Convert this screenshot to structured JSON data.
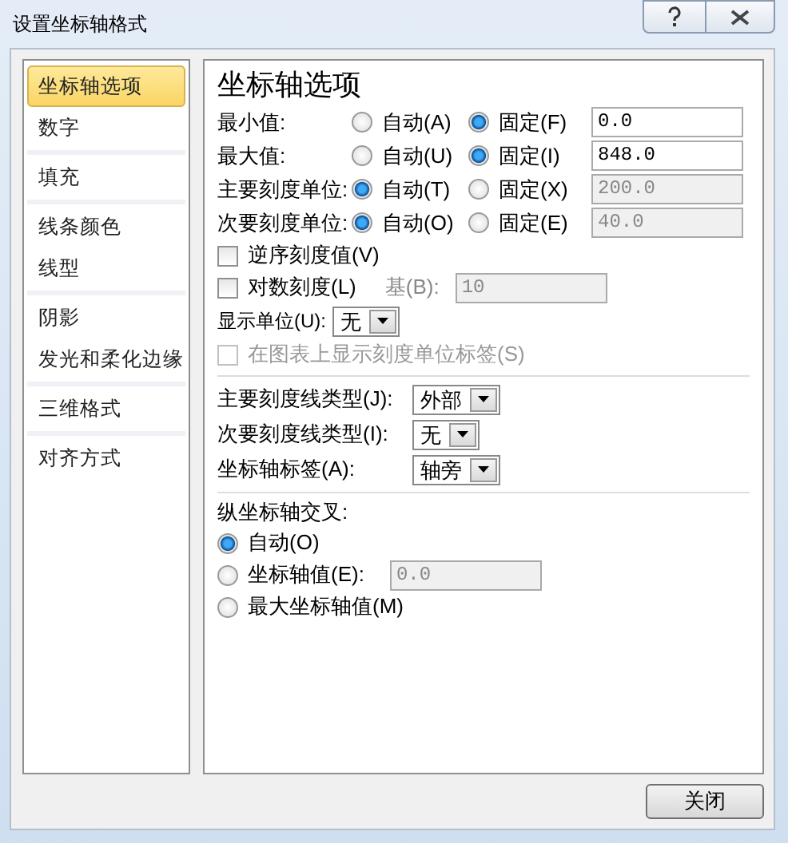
{
  "window": {
    "title": "设置坐标轴格式"
  },
  "sidebar": {
    "groups": [
      [
        {
          "label": "坐标轴选项",
          "selected": true
        },
        {
          "label": "数字",
          "selected": false
        }
      ],
      [
        {
          "label": "填充",
          "selected": false
        }
      ],
      [
        {
          "label": "线条颜色",
          "selected": false
        },
        {
          "label": "线型",
          "selected": false
        }
      ],
      [
        {
          "label": "阴影",
          "selected": false
        },
        {
          "label": "发光和柔化边缘",
          "selected": false
        }
      ],
      [
        {
          "label": "三维格式",
          "selected": false
        }
      ],
      [
        {
          "label": "对齐方式",
          "selected": false
        }
      ]
    ]
  },
  "panel": {
    "title": "坐标轴选项",
    "bounds": [
      {
        "label": "最小值:",
        "options": [
          {
            "label": "自动(A)",
            "selected": false
          },
          {
            "label": "固定(F)",
            "selected": true
          }
        ],
        "value": "0.0",
        "disabled": false
      },
      {
        "label": "最大值:",
        "options": [
          {
            "label": "自动(U)",
            "selected": false
          },
          {
            "label": "固定(I)",
            "selected": true
          }
        ],
        "value": "848.0",
        "disabled": false
      },
      {
        "label": "主要刻度单位:",
        "options": [
          {
            "label": "自动(T)",
            "selected": true
          },
          {
            "label": "固定(X)",
            "selected": false
          }
        ],
        "value": "200.0",
        "disabled": true
      },
      {
        "label": "次要刻度单位:",
        "options": [
          {
            "label": "自动(O)",
            "selected": true
          },
          {
            "label": "固定(E)",
            "selected": false
          }
        ],
        "value": "40.0",
        "disabled": true
      }
    ],
    "reverse": {
      "label": "逆序刻度值(V)",
      "checked": false
    },
    "log": {
      "label": "对数刻度(L)",
      "checked": false,
      "base_label": "基(B):",
      "base_value": "10",
      "base_disabled": true
    },
    "display_units": {
      "label": "显示单位(U):",
      "value": "无"
    },
    "unit_label": {
      "label": "在图表上显示刻度单位标签(S)",
      "checked": false,
      "disabled": true
    },
    "dropdowns": [
      {
        "label": "主要刻度线类型(J):",
        "value": "外部"
      },
      {
        "label": "次要刻度线类型(I):",
        "value": "无"
      },
      {
        "label": "坐标轴标签(A):",
        "value": "轴旁"
      }
    ],
    "crosses": {
      "label": "纵坐标轴交叉:",
      "options": [
        {
          "label": "自动(O)",
          "selected": true
        },
        {
          "label": "坐标轴值(E):",
          "selected": false,
          "value": "0.0",
          "disabled": true
        },
        {
          "label": "最大坐标轴值(M)",
          "selected": false
        }
      ]
    }
  },
  "buttons": [
    "关闭"
  ]
}
